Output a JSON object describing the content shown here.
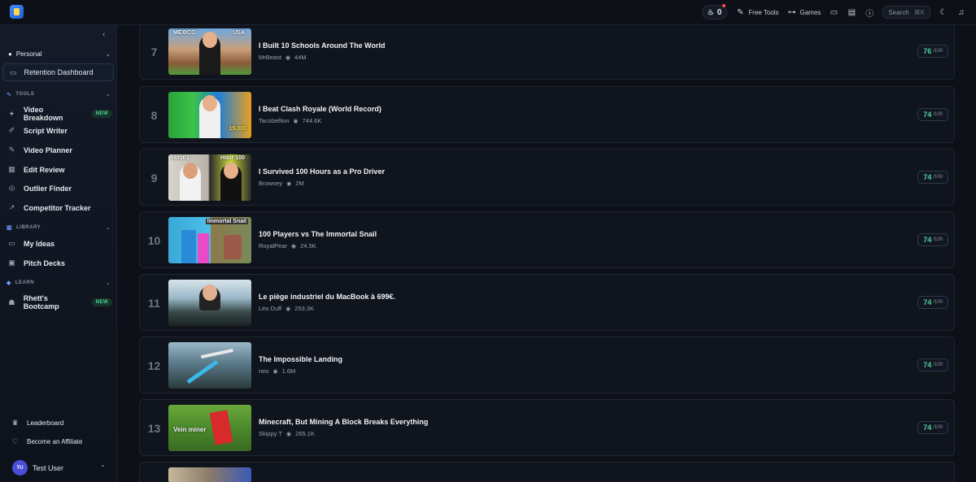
{
  "topbar": {
    "streak_count": "0",
    "free_tools": "Free Tools",
    "games": "Games",
    "search_label": "Search",
    "search_shortcut": "⌘K"
  },
  "sidebar": {
    "workspace": "Personal",
    "active_item": "Retention Dashboard",
    "sections": {
      "tools": "TOOLS",
      "library": "LIBRARY",
      "learn": "LEARN"
    },
    "tools": [
      {
        "label": "Video Breakdown",
        "badge": "NEW"
      },
      {
        "label": "Script Writer"
      },
      {
        "label": "Video Planner"
      },
      {
        "label": "Edit Review"
      },
      {
        "label": "Outlier Finder"
      },
      {
        "label": "Competitor Tracker"
      }
    ],
    "library": [
      {
        "label": "My Ideas"
      },
      {
        "label": "Pitch Decks"
      }
    ],
    "learn": [
      {
        "label": "Rhett's Bootcamp",
        "badge": "NEW"
      }
    ],
    "footer": {
      "leaderboard": "Leaderboard",
      "affiliate": "Become an Affiliate",
      "user_initials": "TU",
      "user_name": "Test User"
    }
  },
  "videos": [
    {
      "rank": "7",
      "title": "I Built 10 Schools Around The World",
      "channel": "MrBeast",
      "views": "44M",
      "score": "76",
      "out_of": "/100"
    },
    {
      "rank": "8",
      "title": "I Beat Clash Royale (World Record)",
      "channel": "Tacobellion",
      "views": "744.6K",
      "score": "74",
      "out_of": "/100"
    },
    {
      "rank": "9",
      "title": "I Survived 100 Hours as a Pro Driver",
      "channel": "Browney",
      "views": "2M",
      "score": "74",
      "out_of": "/100"
    },
    {
      "rank": "10",
      "title": "100 Players vs The Immortal Snail",
      "channel": "RoyalPear",
      "views": "24.5K",
      "score": "74",
      "out_of": "/100"
    },
    {
      "rank": "11",
      "title": "Le piège industriel du MacBook à 699€.",
      "channel": "Léo Duff",
      "views": "253.3K",
      "score": "74",
      "out_of": "/100"
    },
    {
      "rank": "12",
      "title": "The Impossible Landing",
      "channel": "neo",
      "views": "1.6M",
      "score": "74",
      "out_of": "/100"
    },
    {
      "rank": "13",
      "title": "Minecraft, But Mining A Block Breaks Everything",
      "channel": "Skippy T",
      "views": "265.1K",
      "score": "74",
      "out_of": "/100"
    }
  ],
  "thumbnail_text": {
    "t7_left": "MEXICO",
    "t7_right": "USA",
    "t8_right": "15,000",
    "t9_left": "Hour 1",
    "t9_right": "Hour 100",
    "t10_right": "Immortal Snail",
    "t13_left": "Vein miner"
  },
  "colors": {
    "background": "#0d1117",
    "accent_green": "#4fd39a",
    "card_border": "#1f2633"
  }
}
